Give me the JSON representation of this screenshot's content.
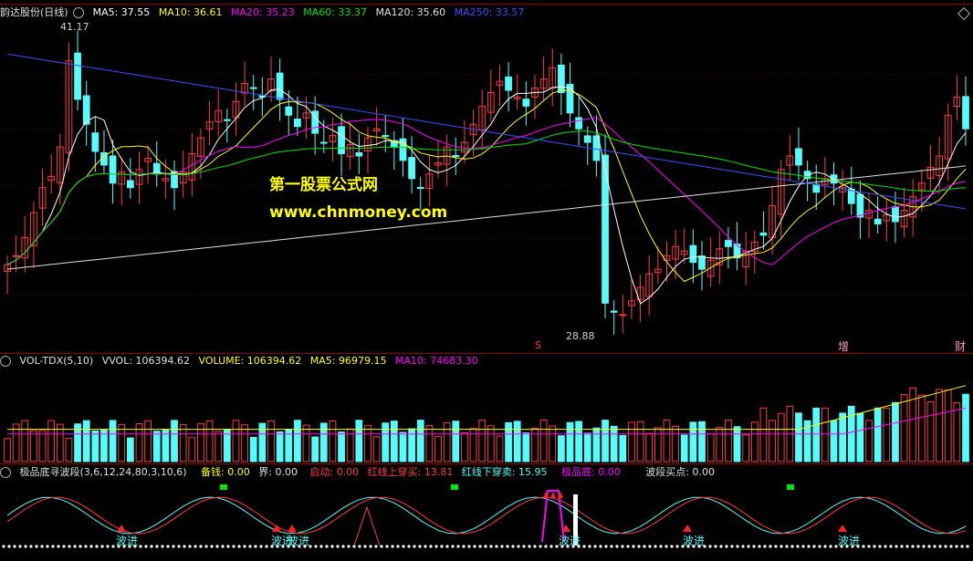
{
  "main_header": {
    "title": "韵达股份(日线)",
    "ma5": "MA5: 37.55",
    "ma10": "MA10: 36.61",
    "ma20": "MA20: 35.23",
    "ma60": "MA60: 33.37",
    "ma120": "MA120: 35.60",
    "ma250": "MA250: 33.57"
  },
  "price_labels": {
    "high": "41.17",
    "low": "28.88"
  },
  "markers": {
    "s": "S",
    "zeng": "增",
    "cai": "财"
  },
  "watermark": {
    "line1": "第一股票公式网",
    "line2": "www.chnmoney.com"
  },
  "vol_header": {
    "title": "VOL-TDX(5,10)",
    "vvol": "VVOL: 106394.62",
    "volume": "VOLUME: 106394.62",
    "ma5": "MA5: 96979.15",
    "ma10": "MA10: 74683.30"
  },
  "ind_header": {
    "title": "极品底寻波段(3,6,12,24,80,3,10,6)",
    "beiqian": "备钱: 0.00",
    "jie": "界: 0.00",
    "qidong": "启动: 0.00",
    "red_up": "红线上穿买: 13.81",
    "red_down": "红线下穿卖: 15.95",
    "jipindi": "极品底: 0.00",
    "boduan": "波段买点: 0.00"
  },
  "signals": {
    "buy": "波进",
    "sell_tag": "卖出"
  },
  "colors": {
    "up": "#ff3c3c",
    "down": "#54fcfc",
    "ma5": "#ffffff",
    "ma10": "#ffff00",
    "ma20": "#ff00ff",
    "ma60": "#00e600",
    "ma120": "#e0e0e0",
    "ma250": "#3c50ff"
  },
  "chart_data": {
    "type": "candlestick",
    "ylim": [
      27.5,
      42.0
    ],
    "closes": [
      31.2,
      31.6,
      32.4,
      33.5,
      34.6,
      35.1,
      36.4,
      40.2,
      38.5,
      37.4,
      36.2,
      35.6,
      34.8,
      35.3,
      34.6,
      35.4,
      35.9,
      35.2,
      35.0,
      34.6,
      35.3,
      36.1,
      36.8,
      37.5,
      38.0,
      37.6,
      38.4,
      39.2,
      39.0,
      38.6,
      39.4,
      38.5,
      37.8,
      37.3,
      37.9,
      37.0,
      36.6,
      36.9,
      36.1,
      36.5,
      36.0,
      36.8,
      37.2,
      36.9,
      36.4,
      35.8,
      35.0,
      34.6,
      35.2,
      35.7,
      36.4,
      36.0,
      36.6,
      37.4,
      38.2,
      38.8,
      39.3,
      38.9,
      38.6,
      38.2,
      39.0,
      39.4,
      39.9,
      38.8,
      37.9,
      37.2,
      36.6,
      35.8,
      29.5,
      29.1,
      29.0,
      29.6,
      30.2,
      30.8,
      31.0,
      31.6,
      32.0,
      31.8,
      31.3,
      31.0,
      31.4,
      31.9,
      32.0,
      31.5,
      31.8,
      32.2,
      32.5,
      33.8,
      35.4,
      36.0,
      35.6,
      35.0,
      34.4,
      35.0,
      34.8,
      34.6,
      33.9,
      33.3,
      33.6,
      33.0,
      33.4,
      33.1,
      33.6,
      34.2,
      34.8,
      35.5,
      36.0,
      37.8,
      38.6,
      37.2
    ]
  }
}
